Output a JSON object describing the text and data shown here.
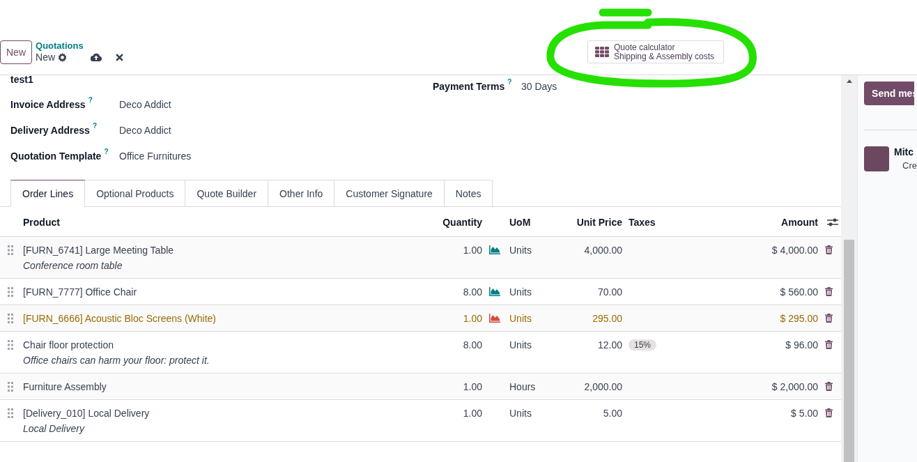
{
  "control_panel": {
    "new_button": "New",
    "breadcrumb_parent": "Quotations",
    "breadcrumb_current": "New"
  },
  "quote_calculator": {
    "title": "Quote calculator",
    "subtitle": "Shipping & Assembly costs"
  },
  "form": {
    "name": "test1",
    "fields": [
      {
        "label": "Invoice Address",
        "help": "?",
        "value": "Deco Addict"
      },
      {
        "label": "Delivery Address",
        "help": "?",
        "value": "Deco Addict"
      },
      {
        "label": "Quotation Template",
        "help": "?",
        "value": "Office Furnitures"
      }
    ],
    "payment_terms": {
      "label": "Payment Terms",
      "help": "?",
      "value": "30 Days"
    }
  },
  "tabs": [
    {
      "label": "Order Lines",
      "selected": true
    },
    {
      "label": "Optional Products",
      "selected": false
    },
    {
      "label": "Quote Builder",
      "selected": false
    },
    {
      "label": "Other Info",
      "selected": false
    },
    {
      "label": "Customer Signature",
      "selected": false
    },
    {
      "label": "Notes",
      "selected": false
    }
  ],
  "table": {
    "columns": [
      "Product",
      "Quantity",
      "UoM",
      "Unit Price",
      "Taxes",
      "Amount"
    ],
    "rows": [
      {
        "product": "[FURN_6741] Large Meeting Table",
        "description": "Conference room table",
        "quantity": "1.00",
        "forecast": {
          "color": "#017e84"
        },
        "uom": "Units",
        "unit_price": "4,000.00",
        "amount": "$ 4,000.00",
        "warning": false
      },
      {
        "product": "[FURN_7777] Office Chair",
        "quantity": "8.00",
        "forecast": {
          "color": "#017e84"
        },
        "uom": "Units",
        "unit_price": "70.00",
        "amount": "$ 560.00",
        "warning": false
      },
      {
        "product": "[FURN_6666] Acoustic Bloc Screens (White)",
        "quantity": "1.00",
        "forecast": {
          "color": "#d44c3b"
        },
        "uom": "Units",
        "unit_price": "295.00",
        "amount": "$ 295.00",
        "warning": true
      },
      {
        "product": "Chair floor protection",
        "description": "Office chairs can harm your floor: protect it.",
        "quantity": "8.00",
        "uom": "Units",
        "unit_price": "12.00",
        "taxes": "15%",
        "amount": "$ 96.00",
        "warning": false
      },
      {
        "product": "Furniture Assembly",
        "quantity": "1.00",
        "uom": "Hours",
        "unit_price": "2,000.00",
        "amount": "$ 2,000.00",
        "warning": false
      },
      {
        "product": "[Delivery_010] Local Delivery",
        "description": "Local Delivery",
        "quantity": "1.00",
        "uom": "Units",
        "unit_price": "5.00",
        "amount": "$ 5.00",
        "warning": false
      }
    ]
  },
  "chatter": {
    "send_button": "Send mes",
    "messages": [
      {
        "author": "Mitc",
        "body": "Cre"
      }
    ]
  }
}
